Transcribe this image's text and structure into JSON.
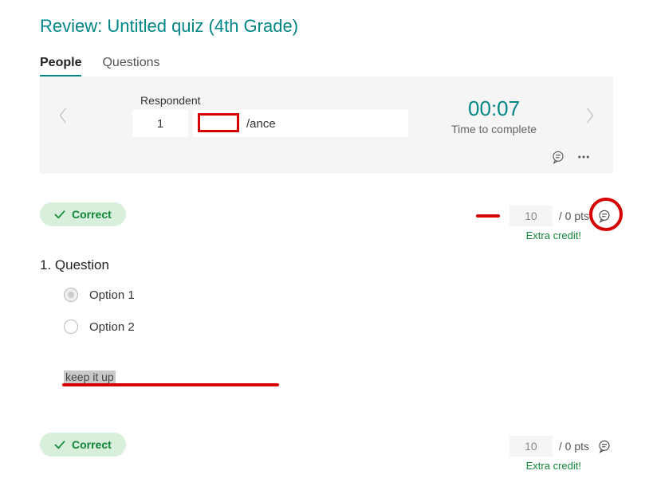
{
  "title": "Review: Untitled quiz (4th Grade)",
  "tabs": {
    "people": "People",
    "questions": "Questions"
  },
  "respondent": {
    "label": "Respondent",
    "index": "1",
    "name_suffix": "/ance",
    "time_value": "00:07",
    "time_label": "Time to complete"
  },
  "q1": {
    "correct_label": "Correct",
    "points_value": "10",
    "points_suffix": "/ 0 pts",
    "extra_credit": "Extra credit!",
    "title": "1. Question",
    "option1": "Option 1",
    "option2": "Option 2",
    "comment": "keep it up"
  },
  "q2": {
    "correct_label": "Correct",
    "points_value": "10",
    "points_suffix": "/ 0 pts",
    "extra_credit": "Extra credit!"
  }
}
